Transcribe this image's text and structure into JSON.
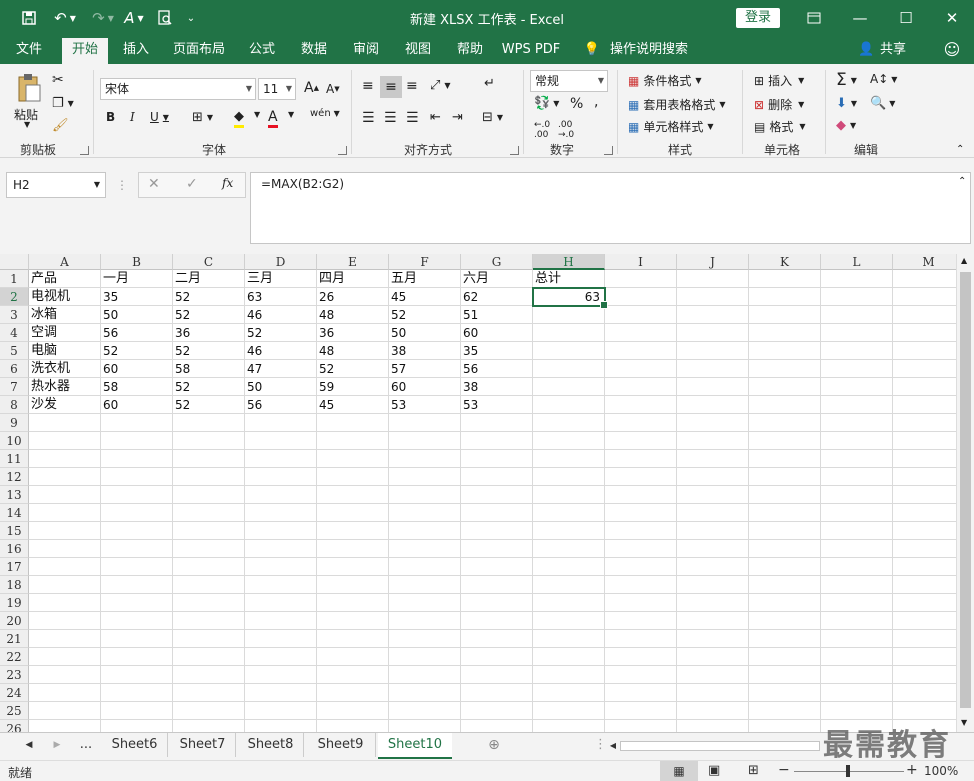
{
  "titlebar": {
    "title": "新建 XLSX 工作表  -  Excel",
    "login": "登录",
    "qa_save_icon": "save-icon",
    "qa_undo_icon": "undo-icon",
    "qa_redo_icon": "redo-icon"
  },
  "tabs": [
    "文件",
    "开始",
    "插入",
    "页面布局",
    "公式",
    "数据",
    "审阅",
    "视图",
    "帮助",
    "WPS PDF",
    "操作说明搜索",
    "共享"
  ],
  "ribbon": {
    "paste": "粘贴",
    "font_name": "宋体",
    "font_size": "11",
    "number_format": "常规",
    "conditional": "条件格式",
    "table_format": "套用表格格式",
    "cell_style": "单元格样式",
    "insert": "插入",
    "delete": "删除",
    "format": "格式",
    "groups": [
      "剪贴板",
      "字体",
      "对齐方式",
      "数字",
      "样式",
      "单元格",
      "编辑"
    ]
  },
  "formula_bar": {
    "name_box": "H2",
    "formula": "=MAX(B2:G2)"
  },
  "sheet": {
    "columns": [
      "A",
      "B",
      "C",
      "D",
      "E",
      "F",
      "G",
      "H",
      "I",
      "J",
      "K",
      "L",
      "M"
    ],
    "row_numbers": [
      "1",
      "2",
      "3",
      "4",
      "5",
      "6",
      "7",
      "8",
      "9",
      "10",
      "11",
      "12",
      "13",
      "14",
      "15",
      "16",
      "17",
      "18",
      "19",
      "20",
      "21",
      "22",
      "23",
      "24",
      "25",
      "26"
    ],
    "rows": [
      [
        "产品",
        "一月",
        "二月",
        "三月",
        "四月",
        "五月",
        "六月",
        "总计"
      ],
      [
        "电视机",
        "35",
        "52",
        "63",
        "26",
        "45",
        "62",
        "63"
      ],
      [
        "冰箱",
        "50",
        "52",
        "46",
        "48",
        "52",
        "51",
        ""
      ],
      [
        "空调",
        "56",
        "36",
        "52",
        "36",
        "50",
        "60",
        ""
      ],
      [
        "电脑",
        "52",
        "52",
        "46",
        "48",
        "38",
        "35",
        ""
      ],
      [
        "洗衣机",
        "60",
        "58",
        "47",
        "52",
        "57",
        "56",
        ""
      ],
      [
        "热水器",
        "58",
        "52",
        "50",
        "59",
        "60",
        "38",
        ""
      ],
      [
        "沙发",
        "60",
        "52",
        "56",
        "45",
        "53",
        "53",
        ""
      ]
    ]
  },
  "sheet_tabs": [
    "...",
    "Sheet6",
    "Sheet7",
    "Sheet8",
    "Sheet9",
    "Sheet10"
  ],
  "status": {
    "ready": "就绪",
    "zoom": "100%"
  },
  "watermark": "最需教育"
}
